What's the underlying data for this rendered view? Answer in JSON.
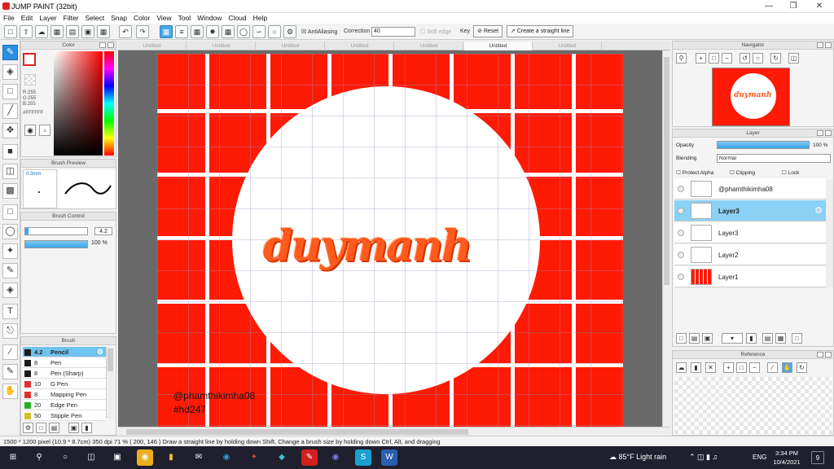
{
  "window": {
    "title": "JUMP PAINT (32bit)"
  },
  "menu": [
    "File",
    "Edit",
    "Layer",
    "Filter",
    "Select",
    "Snap",
    "Color",
    "View",
    "Tool",
    "Window",
    "Cloud",
    "Help"
  ],
  "toolbar": {
    "antialiasing_label": "AntiAliasing",
    "correction_label": "Correction",
    "correction_value": "40",
    "soft_edge_label": "Soft edge",
    "key_label": "Key",
    "reset_label": "Reset",
    "straight_line_label": "Create a straight line"
  },
  "tabs": [
    "Untitled",
    "Untitled",
    "Untitled",
    "Untitled",
    "Untitled",
    "Untitled",
    "Untitled"
  ],
  "active_tab": 5,
  "color_panel": {
    "title": "Color",
    "r": "R:255",
    "g": "G:255",
    "b": "B:255",
    "hex": "#FFFFFF"
  },
  "brush_preview": {
    "title": "Brush Preview",
    "size_label": "0.3mm"
  },
  "brush_control": {
    "title": "Brush Control",
    "size_value": "4.2",
    "opacity_value": "100 %",
    "opacity_fill": 1.0
  },
  "brush_panel": {
    "title": "Brush",
    "items": [
      {
        "size": "4.2",
        "name": "Pencil",
        "color": "#1a1a1a",
        "selected": true
      },
      {
        "size": "8",
        "name": "Pen",
        "color": "#1a1a1a"
      },
      {
        "size": "8",
        "name": "Pen (Sharp)",
        "color": "#1a1a1a"
      },
      {
        "size": "10",
        "name": "G Pen",
        "color": "#e03030"
      },
      {
        "size": "8",
        "name": "Mapping Pen",
        "color": "#e03030"
      },
      {
        "size": "20",
        "name": "Edge Pen",
        "color": "#20b020"
      },
      {
        "size": "50",
        "name": "Stipple Pen",
        "color": "#d0c020"
      }
    ]
  },
  "navigator": {
    "title": "Navigator"
  },
  "layer_panel": {
    "title": "Layer",
    "opacity_label": "Opacity",
    "opacity_value": "100 %",
    "opacity_fill": 1.0,
    "blending_label": "Blending",
    "blending_value": "Normal",
    "protect_alpha_label": "Protect Alpha",
    "clipping_label": "Clipping",
    "lock_label": "Lock",
    "layers": [
      {
        "name": "@phamthikimha08",
        "selected": false
      },
      {
        "name": "Layer3",
        "selected": true
      },
      {
        "name": "Layer3",
        "selected": false
      },
      {
        "name": "Layer2",
        "selected": false
      },
      {
        "name": "Layer1",
        "selected": false
      }
    ]
  },
  "reference": {
    "title": "Reference"
  },
  "canvas": {
    "logo_text": "duymanh",
    "watermark_line1": "@phamthikimha08",
    "watermark_line2": "#hd247",
    "bg_color": "#ff1a05",
    "logo_color": "#ff5a1e"
  },
  "status": {
    "text": "1500 * 1200 pixel   (10.9 * 8.7cm)   350 dpi   71 %   ( 200, 146 )   Draw a straight line by holding down Shift, Change a brush size by holding down Ctrl, Alt, and dragging"
  },
  "taskbar": {
    "weather": "85°F Light rain",
    "lang": "ENG",
    "time": "3:34 PM",
    "date": "10/4/2021",
    "notification_count": "9"
  }
}
